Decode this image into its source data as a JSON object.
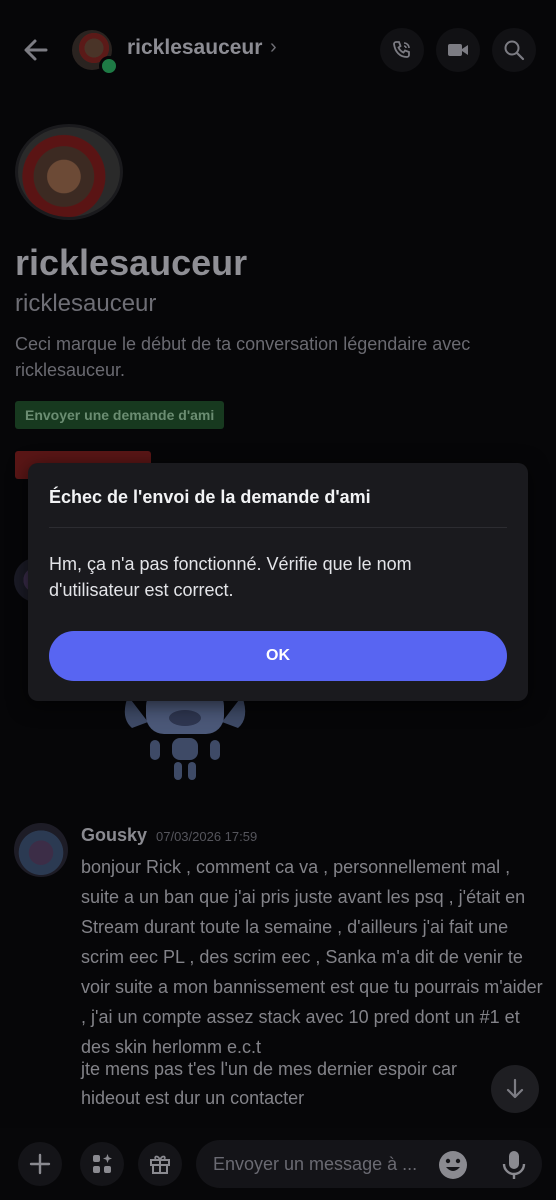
{
  "header": {
    "username": "ricklesauceur",
    "chevron": "›",
    "icons": [
      "back-arrow-icon",
      "phone-call-icon",
      "video-camera-icon",
      "search-icon"
    ]
  },
  "profile": {
    "display_name": "ricklesauceur",
    "username": "ricklesauceur",
    "description": "Ceci marque le début de ta conversation légendaire avec ricklesauceur.",
    "friend_request_label": "Envoyer une demande d'ami"
  },
  "messages": [
    {
      "author": "Gousky",
      "timestamp": "07/03/2026 17:59",
      "text_1": "bonjour Rick , comment ca va , personnellement mal , suite a un ban que j'ai pris juste avant les psq  , j'était en Stream durant toute la semaine , d'ailleurs j'ai fait une scrim eec PL , des scrim eec , Sanka  m'a dit de venir te voir suite a mon bannissement est que tu pourrais m'aider , j'ai  un compte assez stack avec 10 pred dont un #1 et des skin herlomm e.c.t",
      "text_2": "jte mens pas t'es l'un de mes dernier espoir car hideout est dur un contacter"
    }
  ],
  "composer": {
    "placeholder": "Envoyer un message à ..."
  },
  "dialog": {
    "title": "Échec de l'envoi de la demande d'ami",
    "body": "Hm, ça n'a pas fonctionné. Vérifie que le nom d'utilisateur est correct.",
    "ok_label": "OK"
  },
  "colors": {
    "background": "#060608",
    "modal_bg": "#1a1a1e",
    "primary_button": "#5865f2",
    "friend_button": "#17391f",
    "report_button": "#5a1616",
    "online_status": "#1e7a45"
  }
}
